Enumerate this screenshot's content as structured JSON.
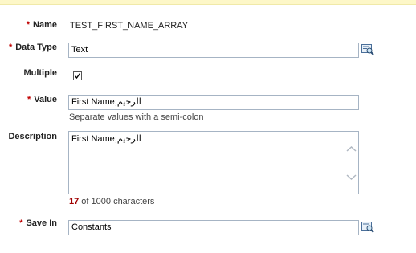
{
  "form": {
    "required_marker": "*",
    "name": {
      "label": "Name",
      "value": "TEST_FIRST_NAME_ARRAY"
    },
    "data_type": {
      "label": "Data Type",
      "value": "Text",
      "lookup_icon": "lookup-icon"
    },
    "multiple": {
      "label": "Multiple",
      "checked": true
    },
    "value": {
      "label": "Value",
      "value": "First Name;الرحيم",
      "hint": "Separate values with a semi-colon"
    },
    "description": {
      "label": "Description",
      "value": "First Name;الرحيم",
      "char_count": "17",
      "char_count_suffix": " of 1000 characters"
    },
    "save_in": {
      "label": "Save In",
      "value": "Constants",
      "lookup_icon": "lookup-icon"
    }
  },
  "colors": {
    "required": "#c00000",
    "count": "#a00000",
    "input_border": "#a6b4c4",
    "top_bar": "#fdf7c8"
  }
}
